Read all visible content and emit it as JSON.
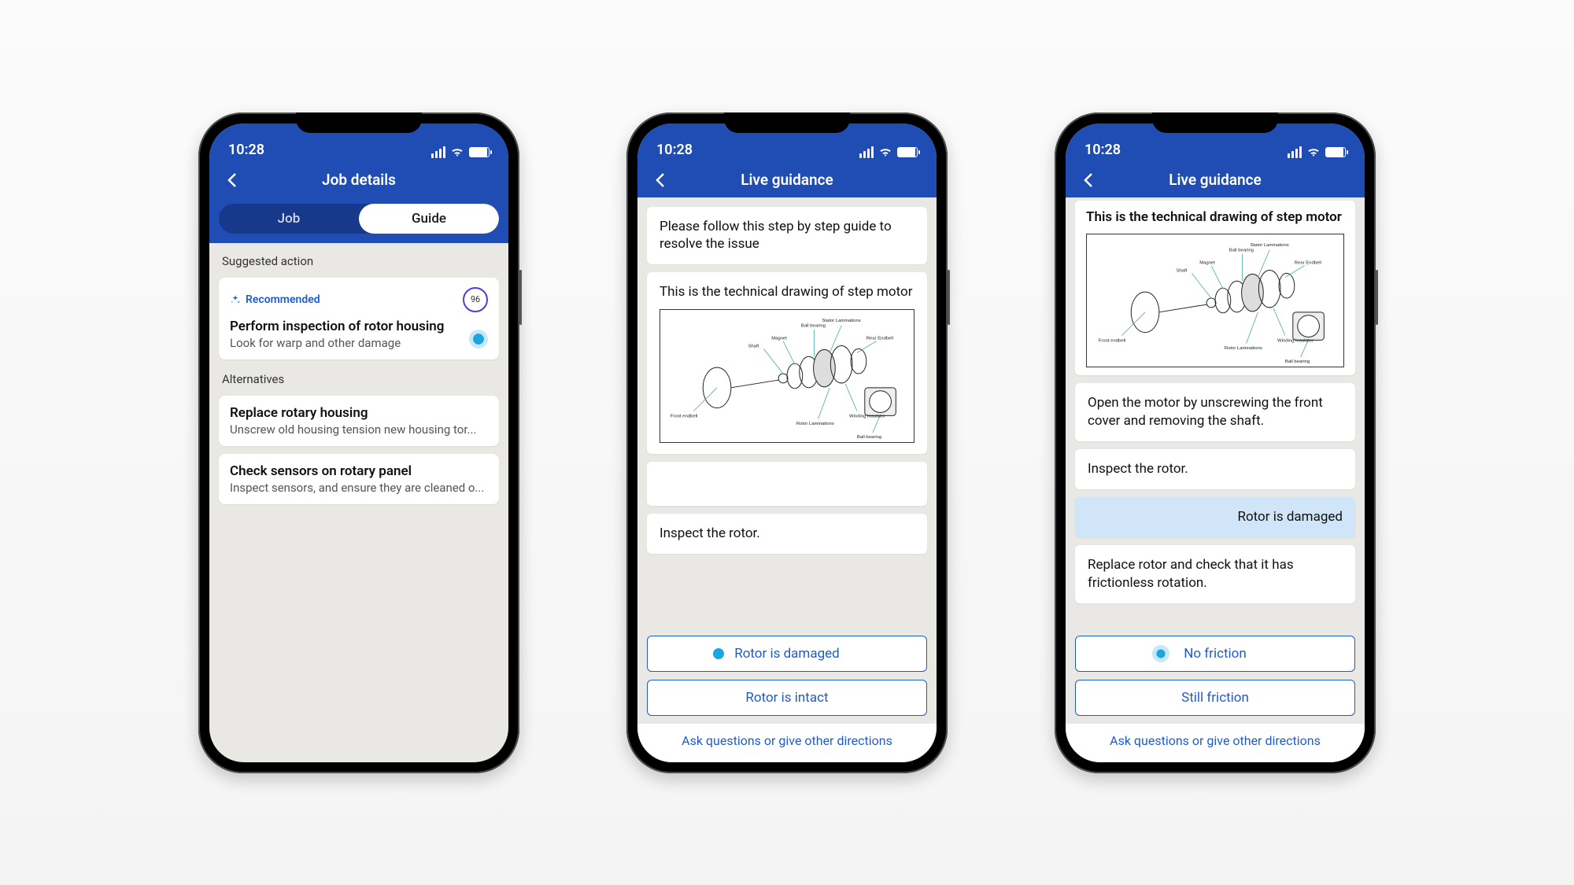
{
  "status": {
    "time": "10:28"
  },
  "phone1": {
    "nav_title": "Job details",
    "seg": {
      "job": "Job",
      "guide": "Guide"
    },
    "section_suggested": "Suggested action",
    "section_alt": "Alternatives",
    "rec_label": "Recommended",
    "rec_score": "96",
    "rec_title": "Perform inspection of rotor housing",
    "rec_sub": "Look for warp and other damage",
    "alt1_title": "Replace rotary housing",
    "alt1_sub": "Unscrew old housing tension new housing tor...",
    "alt2_title": "Check sensors on rotary panel",
    "alt2_sub": "Inspect sensors, and ensure they are cleaned o..."
  },
  "phone2": {
    "nav_title": "Live guidance",
    "msg_intro": "Please follow this step by step guide to resolve the issue",
    "msg_drawing": "This is the technical drawing of step motor",
    "msg_inspect": "Inspect the rotor.",
    "opt1": "Rotor is damaged",
    "opt2": "Rotor is intact",
    "ask": "Ask questions or give other directions"
  },
  "phone3": {
    "nav_title": "Live guidance",
    "msg_drawing": "This is the technical drawing of step motor",
    "msg_open": "Open the motor by unscrewing the front cover and removing the shaft.",
    "msg_inspect": "Inspect the rotor.",
    "msg_user": "Rotor is damaged",
    "msg_replace": "Replace rotor and check that it has frictionless rotation.",
    "opt1": "No friction",
    "opt2": "Still friction",
    "ask": "Ask questions or give other directions"
  },
  "drawing_labels": {
    "stator": "Stator Laminations",
    "ball": "Ball bearing",
    "magnet": "Magnet",
    "shaft": "Shaft",
    "front": "Front endbell",
    "rear": "Rear Endbell",
    "winding": "Winding Insulator",
    "rotor": "Rotor Laminations",
    "ball2": "Ball bearing"
  }
}
